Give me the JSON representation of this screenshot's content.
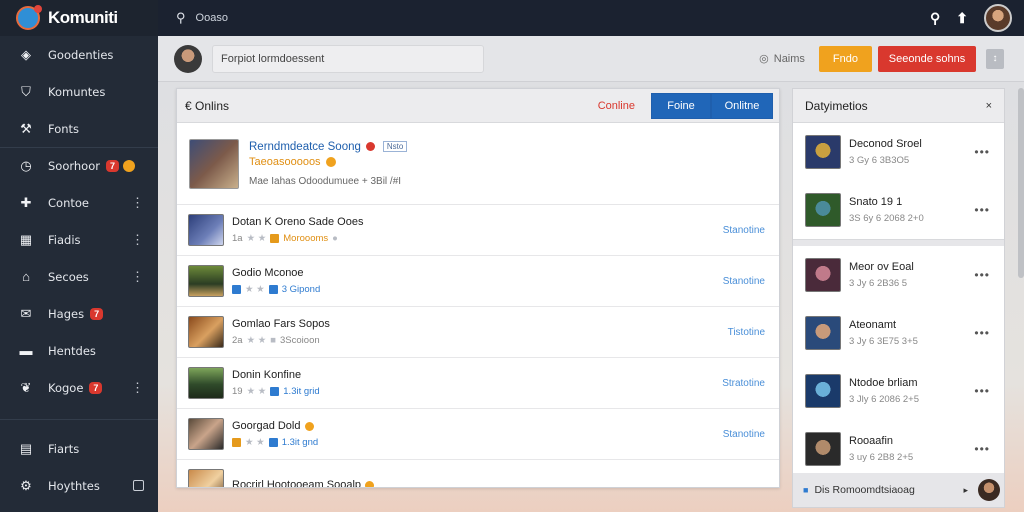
{
  "app": {
    "name": "Komuniti"
  },
  "search": {
    "placeholder": "Ooaso"
  },
  "sidebar": {
    "items": [
      {
        "icon": "shield-icon",
        "glyph": "◈",
        "label": "Goodenties"
      },
      {
        "icon": "badge-icon",
        "glyph": "⛉",
        "label": "Komuntes"
      },
      {
        "icon": "hammer-icon",
        "glyph": "⚒",
        "label": "Fonts"
      },
      {
        "icon": "clock-icon",
        "glyph": "◷",
        "label": "Soorhoor",
        "badge": "7"
      },
      {
        "icon": "plus-box-icon",
        "glyph": "✚",
        "label": "Contoe"
      },
      {
        "icon": "grid-icon",
        "glyph": "▦",
        "label": "Fiadis"
      },
      {
        "icon": "store-icon",
        "glyph": "⌂",
        "label": "Secoes"
      },
      {
        "icon": "mail-icon",
        "glyph": "✉",
        "label": "Hages",
        "badge": "7"
      },
      {
        "icon": "window-icon",
        "glyph": "▬",
        "label": "Hentdes"
      },
      {
        "icon": "bird-icon",
        "glyph": "❦",
        "label": "Kogoe",
        "badge": "7"
      }
    ],
    "bottom": [
      {
        "icon": "building-icon",
        "glyph": "▤",
        "label": "Fiarts"
      },
      {
        "icon": "gear-icon",
        "glyph": "⚙",
        "label": "Hoythtes"
      }
    ]
  },
  "subheader": {
    "input_value": "Forpiot lormdoessent",
    "status": "Naims",
    "orange_btn": "Fndo",
    "red_btn": "Seeonde sohns",
    "gray_btn": "↕"
  },
  "online_panel": {
    "title": "€ Onlins",
    "online_label": "Conline",
    "tabs": [
      "Foine",
      "Onlitne"
    ],
    "featured": {
      "title": "Rerndmdeatce Soong",
      "tag": "Nsto",
      "subtitle": "Taeoasooooos",
      "meta": "Mae Iahas Odoodumuee + 3Bil /#I"
    },
    "rows": [
      {
        "title": "Dotan K Oreno Sade Ooes",
        "rating": "1a",
        "value": "Moroooms",
        "action": "Stanotine",
        "tone": "orange"
      },
      {
        "title": "Godio Mconoe",
        "rating": "",
        "value": "3 Gipond",
        "action": "Stanotine",
        "tone": "blue"
      },
      {
        "title": "Gomlao Fars Sopos",
        "rating": "2a",
        "value": "3Scoioon",
        "action": "Tistotine",
        "tone": "gray"
      },
      {
        "title": "Donin Konfine",
        "rating": "19",
        "value": "1.3it grid",
        "action": "Stratotine",
        "tone": "blue"
      },
      {
        "title": "Goorgad Dold",
        "rating": "",
        "value": "1.3it gnd",
        "action": "Stanotine",
        "tone": "blue"
      },
      {
        "title": "Rocrirl Hootooeam Sooalp",
        "rating": "",
        "value": "",
        "action": "",
        "tone": "orange"
      }
    ]
  },
  "side_panel": {
    "title": "Datyimetios",
    "close": "×",
    "items": [
      {
        "name": "Deconod Sroel",
        "date": "3 Gy 6 3B3O5"
      },
      {
        "name": "Snato 19 1",
        "date": "3S 6y 6 2068 2+0"
      },
      {
        "name": "Meor ov Eoal",
        "date": "3 Jy 6 2B36 5"
      },
      {
        "name": "Ateonamt",
        "date": "3 Jy 6 3E75 3+5"
      },
      {
        "name": "Ntodoe brliam",
        "date": "3 Jly 6 2086 2+5"
      },
      {
        "name": "Rooaafin",
        "date": "3 uy 6 2B8 2+5"
      }
    ],
    "footer": "Dis Romoomdtsiaoag"
  },
  "colors": {
    "sidebar": "#232b37",
    "topbar": "#1b2230",
    "primary": "#2066b8",
    "accent_orange": "#f0a21e",
    "accent_red": "#d9382e"
  }
}
